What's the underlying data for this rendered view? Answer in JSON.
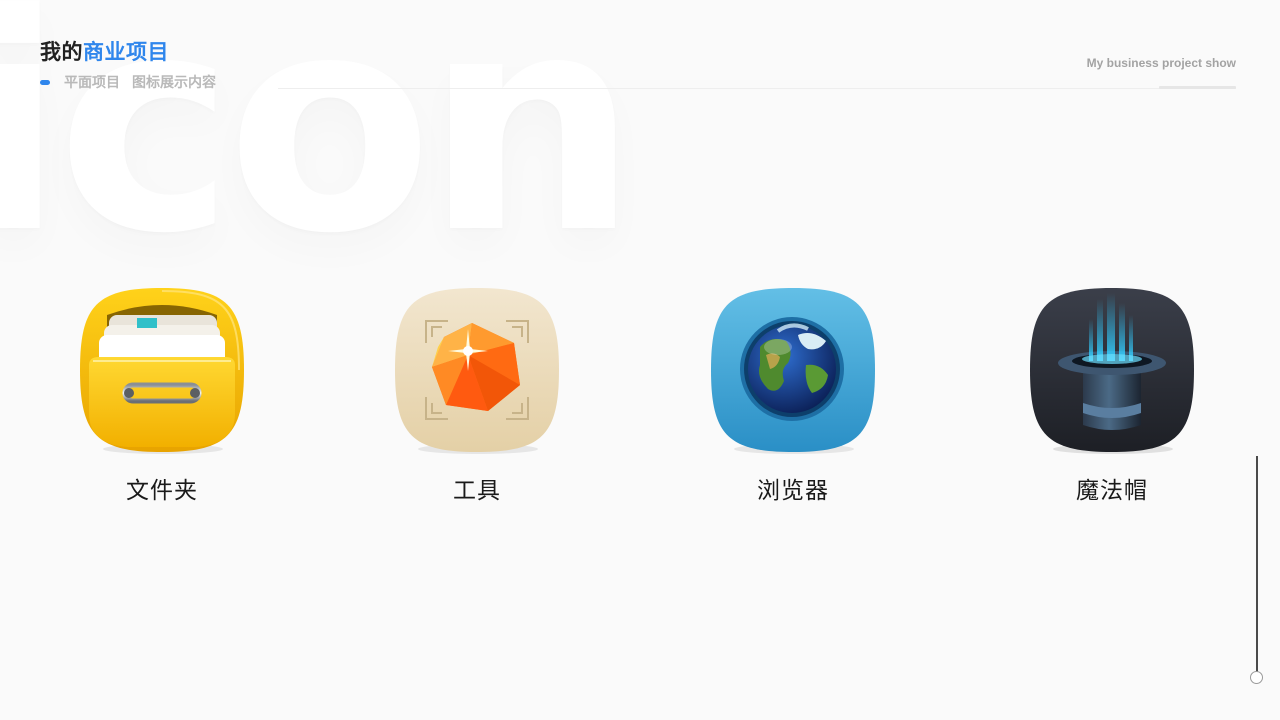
{
  "watermark": "icon",
  "header": {
    "title_prefix": "我的",
    "title_accent": "商业项目",
    "subtitle_1": "平面项目",
    "subtitle_2": "图标展示内容",
    "english_caption": "My business project show"
  },
  "colors": {
    "accent": "#2f86ec",
    "background": "#fafafa"
  },
  "icons": [
    {
      "label": "文件夹",
      "icon": "folder-drawer-icon"
    },
    {
      "label": "工具",
      "icon": "gem-tool-icon"
    },
    {
      "label": "浏览器",
      "icon": "globe-browser-icon"
    },
    {
      "label": "魔法帽",
      "icon": "magic-hat-icon"
    }
  ]
}
